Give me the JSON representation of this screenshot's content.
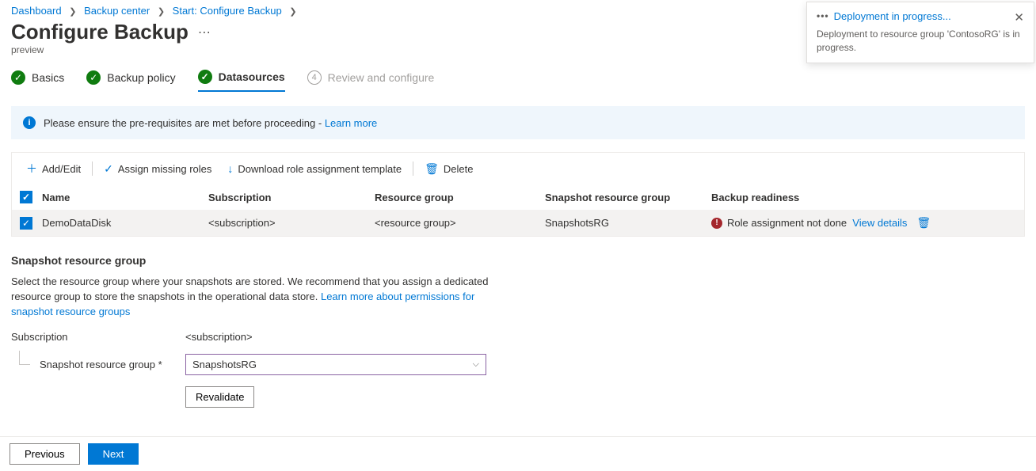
{
  "breadcrumb": {
    "items": [
      "Dashboard",
      "Backup center",
      "Start: Configure Backup"
    ]
  },
  "page": {
    "title": "Configure Backup",
    "subtitle": "preview"
  },
  "stepper": {
    "step1": "Basics",
    "step2": "Backup policy",
    "step3": "Datasources",
    "step4": "Review and configure",
    "step4_num": "4"
  },
  "infobox": {
    "text": "Please ensure the pre-requisites are met before proceeding - ",
    "link": "Learn more"
  },
  "cmdbar": {
    "add": "Add/Edit",
    "assign": "Assign missing roles",
    "download": "Download role assignment template",
    "delete": "Delete"
  },
  "table": {
    "headers": {
      "name": "Name",
      "subscription": "Subscription",
      "rg": "Resource group",
      "snapshot_rg": "Snapshot resource group",
      "readiness": "Backup readiness"
    },
    "row": {
      "name": "DemoDataDisk",
      "subscription": "<subscription>",
      "rg": "<resource group>",
      "snapshot_rg": "SnapshotsRG",
      "readiness_text": "Role assignment not done",
      "readiness_link": "View details"
    }
  },
  "section": {
    "heading": "Snapshot resource group",
    "desc": "Select the resource group where your snapshots are stored. We recommend that you assign a dedicated resource group to store the snapshots in the operational data store. ",
    "desc_link": "Learn more about permissions for snapshot resource groups",
    "subscription_label": "Subscription",
    "subscription_value": "<subscription>",
    "snapshot_label": "Snapshot resource group *",
    "snapshot_value": "SnapshotsRG",
    "revalidate": "Revalidate"
  },
  "footer": {
    "previous": "Previous",
    "next": "Next"
  },
  "toast": {
    "title": "Deployment in progress...",
    "body": "Deployment to resource group 'ContosoRG' is in progress."
  }
}
